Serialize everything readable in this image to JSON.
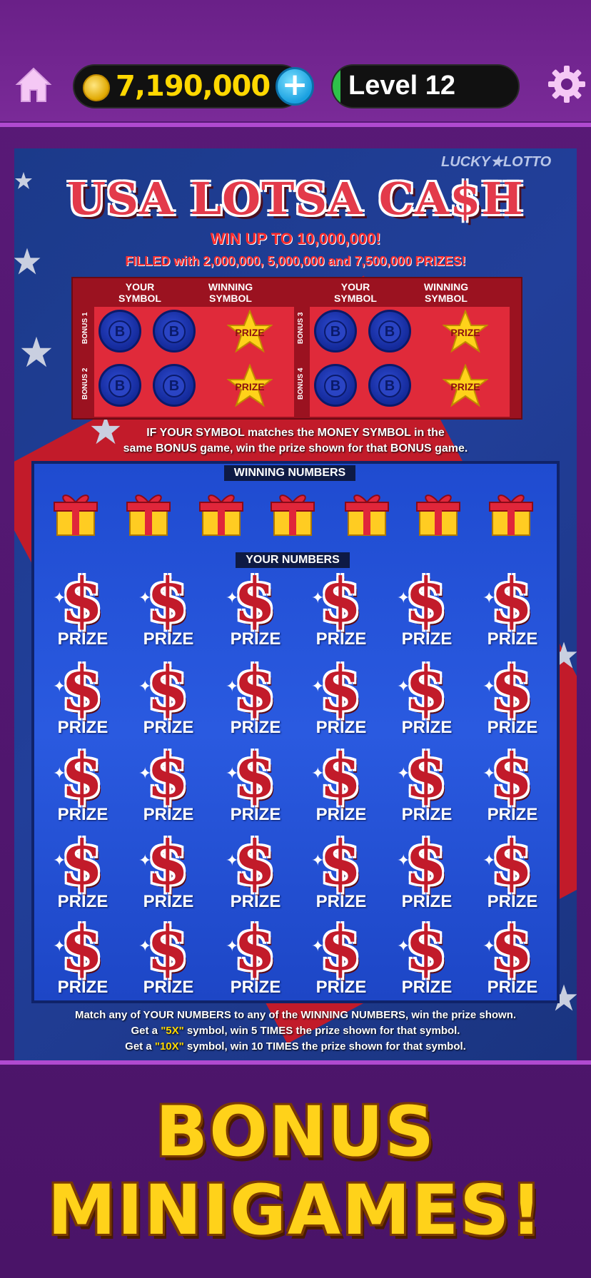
{
  "header": {
    "coins": "7,190,000",
    "level": "Level 12",
    "plus_label": "+",
    "level_progress": 0.04
  },
  "ticket": {
    "brand": "LUCKY★LOTTO",
    "title": "USA LOTSA CA$H",
    "subtitle": "WIN UP TO  10,000,000!",
    "filled": "FILLED with 2,000,000, 5,000,000 and 7,500,000 PRIZES!",
    "bonus": {
      "your_symbol": "YOUR SYMBOL",
      "winning_symbol": "WINNING SYMBOL",
      "rows": [
        "BONUS 1",
        "BONUS 2",
        "BONUS 3",
        "BONUS 4"
      ],
      "coin_letter": "B",
      "prize_label": "PRIZE"
    },
    "rule1": "IF YOUR SYMBOL matches the MONEY SYMBOL in the",
    "rule2": "same BONUS game, win the prize shown for that BONUS game.",
    "winning_numbers_label": "WINNING NUMBERS",
    "your_numbers_label": "YOUR NUMBERS",
    "prize_label": "PRIZE",
    "bottom_rule1": "Match any of YOUR NUMBERS to any of the WINNING NUMBERS, win the prize shown.",
    "bottom_rule2_pre": "Get a ",
    "bottom_rule2_hl": "\"5X\"",
    "bottom_rule2_post": " symbol, win 5 TIMES the prize shown for that symbol.",
    "bottom_rule3_pre": "Get a ",
    "bottom_rule3_hl": "\"10X\"",
    "bottom_rule3_post": "  symbol, win 10 TIMES the prize shown for that symbol."
  },
  "banner": {
    "line1": "BONUS",
    "line2": "MINIGAMES!"
  },
  "colors": {
    "accent_gold": "#ffd800",
    "brand_purple": "#6a2088",
    "ticket_blue": "#1f4bd0",
    "ticket_red": "#c21b2a"
  }
}
